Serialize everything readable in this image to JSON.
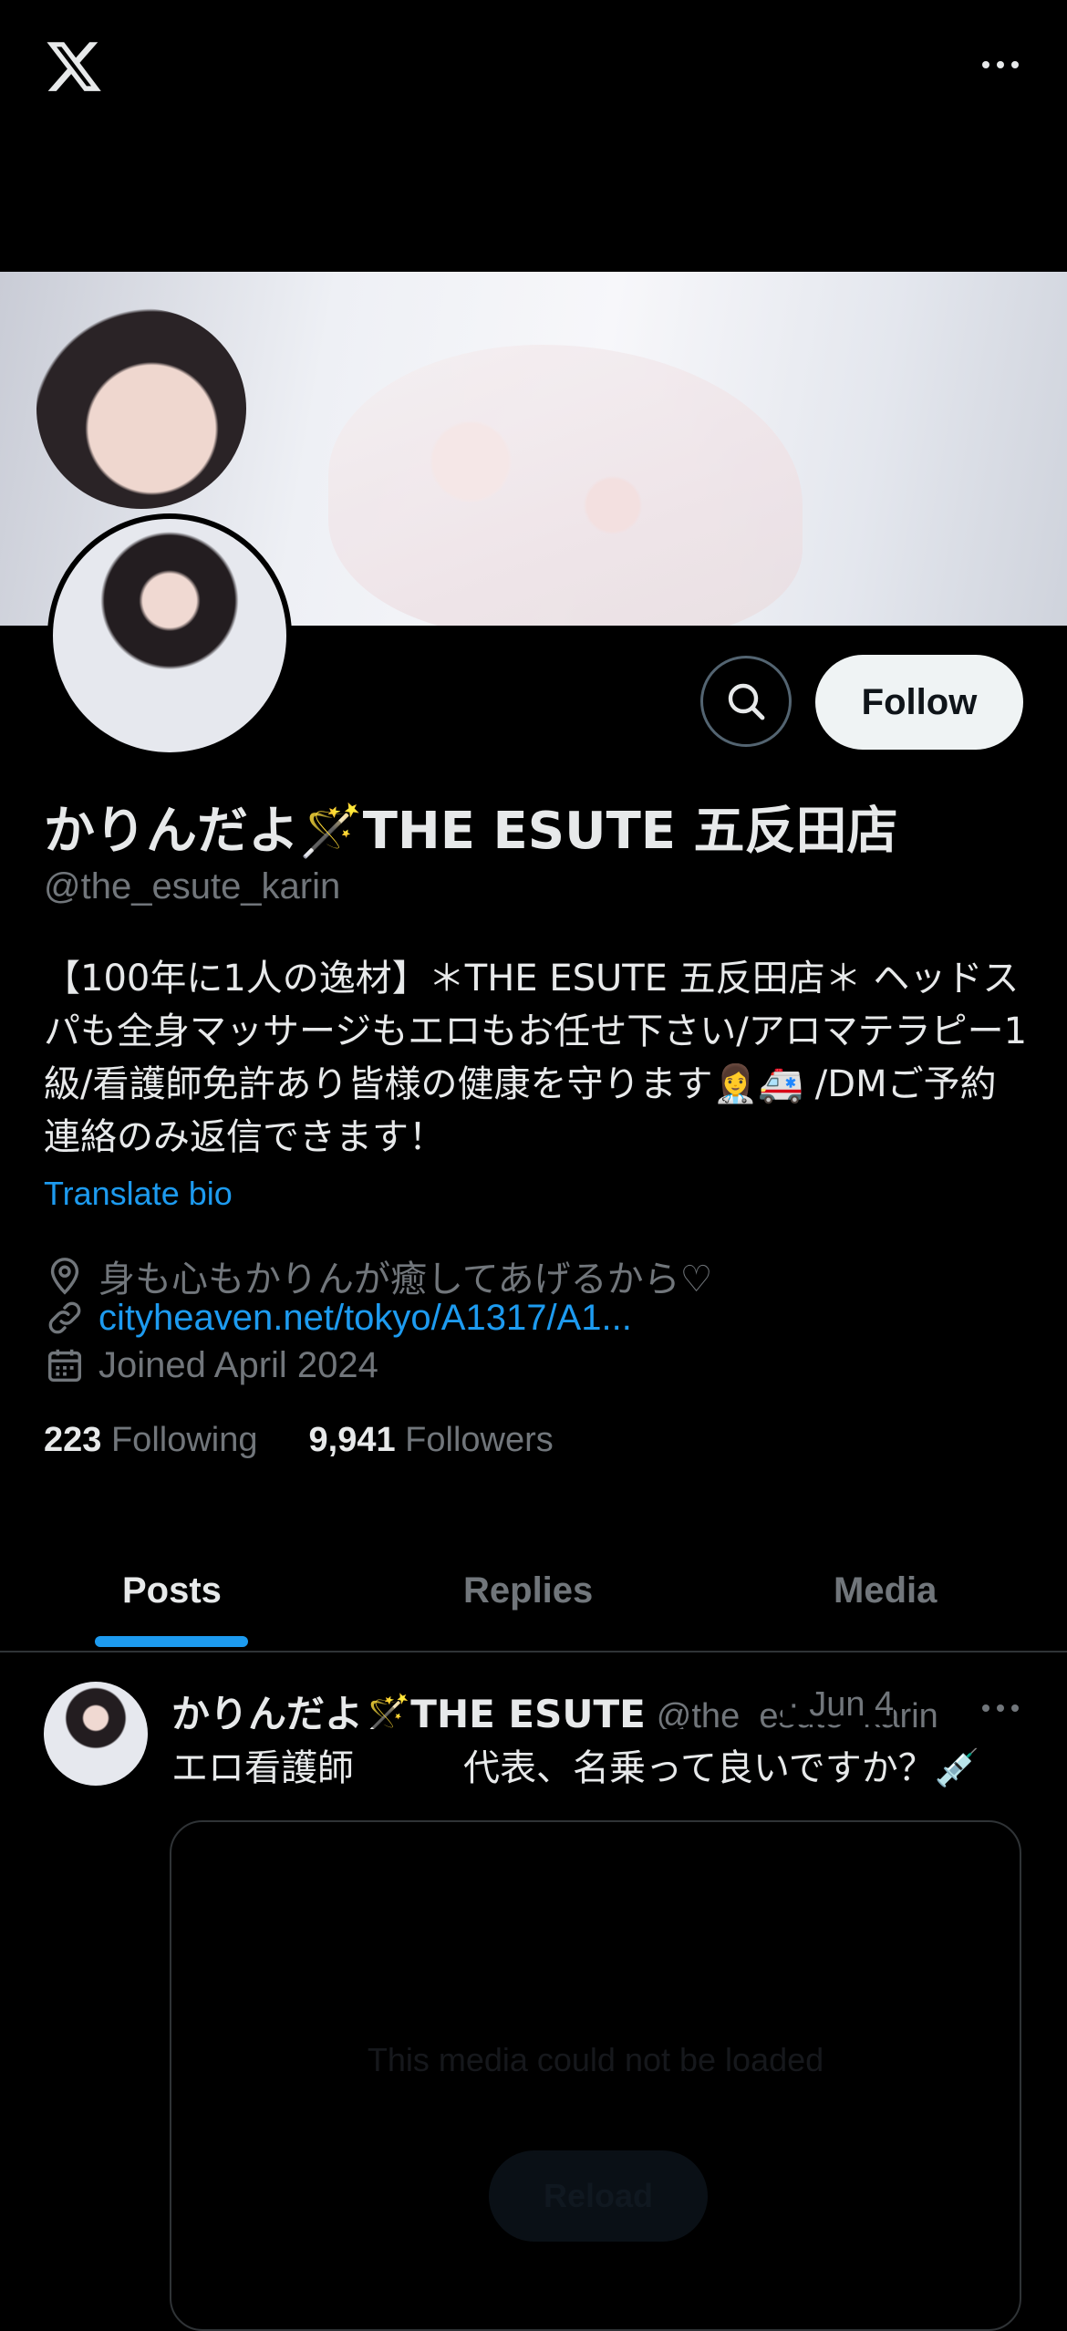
{
  "colors": {
    "accent": "#1d9bf0",
    "background": "#000000",
    "muted": "#71767b",
    "text": "#e7e9ea"
  },
  "icons": {
    "app_logo": "x-logo-icon",
    "more": "more-horizontal-icon",
    "search": "search-icon",
    "location": "location-pin-icon",
    "link": "link-icon",
    "calendar": "calendar-icon"
  },
  "profile": {
    "follow_label": "Follow",
    "display_name": "かりんだよ🪄THE ESUTE 五反田店",
    "handle": "@the_esute_karin",
    "bio": "【100年に1人の逸材】＊THE ESUTE 五反田店＊ ヘッドスパも全身マッサージもエロもお任せ下さい/アロマテラピー1級/看護師免許あり皆様の健康を守ります👩‍⚕️🚑 /DMご予約連絡のみ返信できます！",
    "translate_label": "Translate bio",
    "location": "身も心もかりんが癒してあげるから♡",
    "link": "cityheaven.net/tokyo/A1317/A1...",
    "joined": "Joined April 2024",
    "following_count": "223",
    "following_label": "Following",
    "followers_count": "9,941",
    "followers_label": "Followers"
  },
  "tabs": [
    {
      "label": "Posts",
      "active": true
    },
    {
      "label": "Replies",
      "active": false
    },
    {
      "label": "Media",
      "active": false
    }
  ],
  "post": {
    "name": "かりんだよ🪄THE ESUTE",
    "handle": "@the_esute_karin",
    "date": "· Jun 4",
    "text": "エロ看護師　　　代表、名乗って良いですか？💉",
    "media_message": "This media could not be loaded",
    "reload_label": "Reload"
  }
}
